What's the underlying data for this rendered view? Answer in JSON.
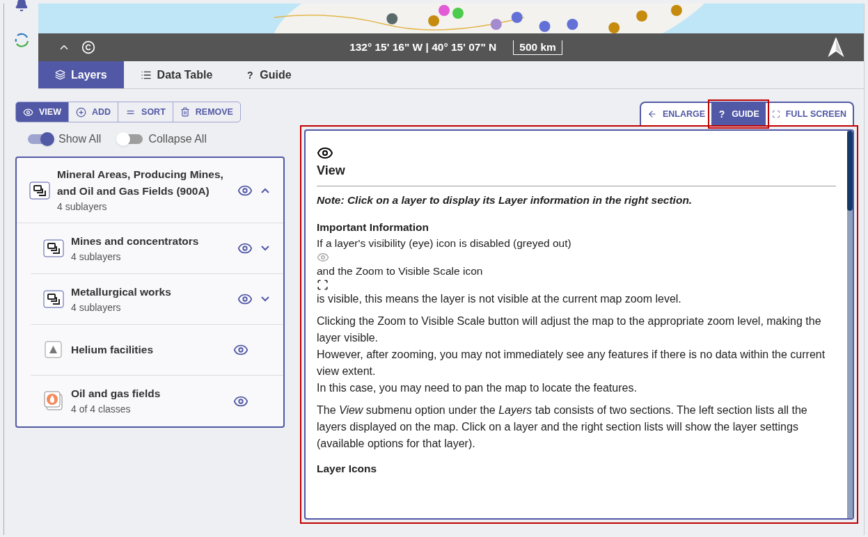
{
  "map_bar": {
    "coordinates": "132° 15' 16\" W | 40° 15' 07\" N",
    "scale": "500 km"
  },
  "tabs": [
    {
      "label": "Layers",
      "selected": true
    },
    {
      "label": "Data Table",
      "selected": false
    },
    {
      "label": "Guide",
      "glyph": "?",
      "selected": false
    }
  ],
  "toolbar": [
    {
      "label": "VIEW",
      "selected": true
    },
    {
      "label": "ADD",
      "selected": false
    },
    {
      "label": "SORT",
      "selected": false
    },
    {
      "label": "REMOVE",
      "selected": false
    }
  ],
  "toggles": [
    {
      "label": "Show All",
      "on": true
    },
    {
      "label": "Collapse All",
      "on": false
    }
  ],
  "layers": [
    {
      "kind": "group",
      "title": "Mineral Areas, Producing Mines, and Oil and Gas Fields (900A)",
      "subtitle": "4 sublayers",
      "expanded": true,
      "children": [
        {
          "kind": "group",
          "title": "Mines and concentrators",
          "subtitle": "4 sublayers",
          "expanded": false
        },
        {
          "kind": "group",
          "title": "Metallurgical works",
          "subtitle": "4 sublayers",
          "expanded": false
        },
        {
          "kind": "helium",
          "title": "Helium facilities"
        },
        {
          "kind": "oil",
          "title": "Oil and gas fields",
          "subtitle": "4 of 4 classes"
        }
      ]
    }
  ],
  "panel_buttons": [
    {
      "label": "ENLARGE",
      "selected": false,
      "highlighted": false
    },
    {
      "label": "GUIDE",
      "glyph": "?",
      "selected": true,
      "highlighted": true
    },
    {
      "label": "FULL SCREEN",
      "selected": false,
      "highlighted": false
    }
  ],
  "guide": {
    "highlighted": true,
    "blocks": [
      {
        "kind": "eye"
      },
      {
        "kind": "title",
        "text": "View"
      },
      {
        "kind": "note",
        "text": "Note: Click on a layer to display its Layer information in the right section."
      },
      {
        "kind": "heading",
        "text": "Important Information"
      },
      {
        "kind": "line",
        "text": "If a layer's visibility (eye) icon is disabled (greyed out)"
      },
      {
        "kind": "greyed-eye"
      },
      {
        "kind": "line",
        "text": "and the Zoom to Visible Scale icon"
      },
      {
        "kind": "zoom"
      },
      {
        "kind": "paragraph",
        "lines": [
          "is visible, this means the layer is not visible at the current map zoom level."
        ]
      },
      {
        "kind": "paragraph",
        "lines": [
          "Clicking the Zoom to Visible Scale button will adjust the map to the appropriate zoom level, making the layer visible.",
          "However, after zooming, you may not immediately see any features if there is no data within the current view extent.",
          "In this case, you may need to pan the map to locate the features."
        ]
      },
      {
        "kind": "paragraph",
        "lines": [
          "The *View* submenu option under the *Layers* tab consists of two sections. The left section lists all the layers displayed on the map. Click on a layer and the right section lists will show the layer settings (available options for that layer)."
        ]
      },
      {
        "kind": "heading",
        "text": "Layer Icons"
      }
    ]
  }
}
